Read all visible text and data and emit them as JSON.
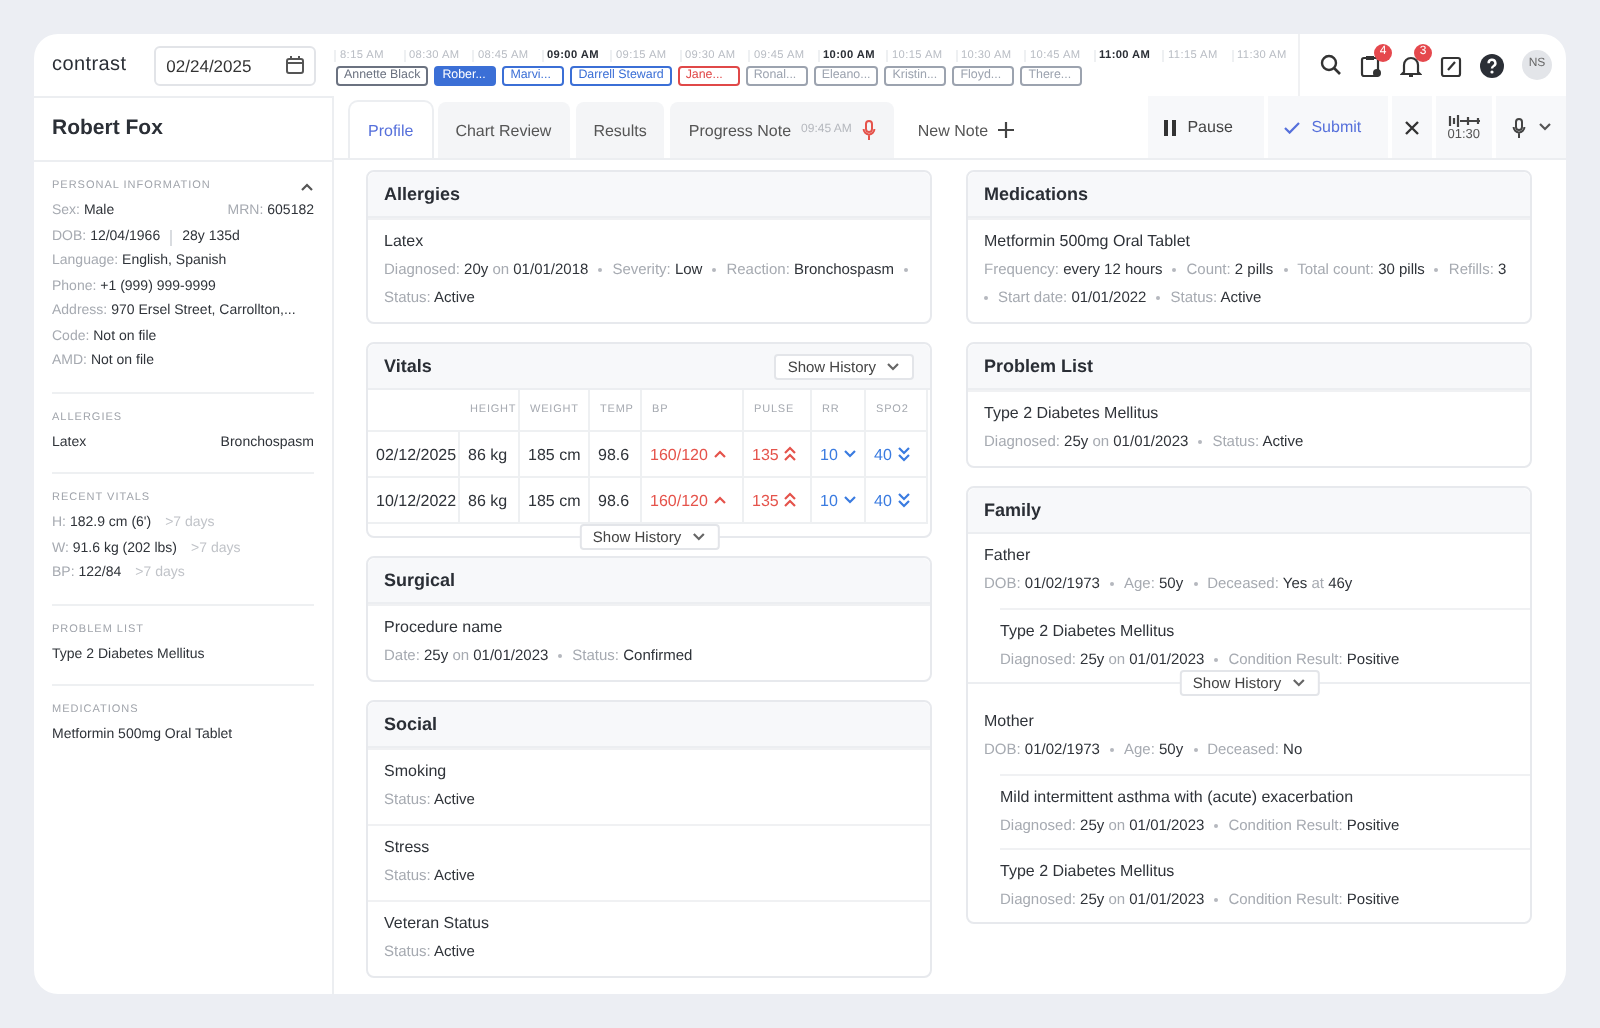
{
  "app": {
    "logo": "contrast",
    "date": "02/24/2025"
  },
  "schedule": {
    "times": [
      {
        "label": "8:15 AM",
        "major": false
      },
      {
        "label": "08:30 AM",
        "major": false
      },
      {
        "label": "08:45 AM",
        "major": false
      },
      {
        "label": "09:00 AM",
        "major": true
      },
      {
        "label": "09:15 AM",
        "major": false
      },
      {
        "label": "09:30 AM",
        "major": false
      },
      {
        "label": "09:45 AM",
        "major": false
      },
      {
        "label": "10:00 AM",
        "major": true
      },
      {
        "label": "10:15 AM",
        "major": false
      },
      {
        "label": "10:30 AM",
        "major": false
      },
      {
        "label": "10:45 AM",
        "major": false
      },
      {
        "label": "11:00 AM",
        "major": true
      },
      {
        "label": "11:15 AM",
        "major": false
      },
      {
        "label": "11:30 AM",
        "major": false
      }
    ],
    "appointments": [
      {
        "name": "Annette Black",
        "color": "#6b7280",
        "selected": false
      },
      {
        "name": "Rober...",
        "color": "#3b6fd6",
        "selected": true
      },
      {
        "name": "Marvi...",
        "color": "#3b6fd6",
        "selected": false
      },
      {
        "name": "Darrell Steward",
        "color": "#3b6fd6",
        "selected": false
      },
      {
        "name": "Jane...",
        "color": "#e04848",
        "selected": false
      },
      {
        "name": "Ronal...",
        "color": "#9ca3af",
        "selected": false
      },
      {
        "name": "Eleano...",
        "color": "#9ca3af",
        "selected": false
      },
      {
        "name": "Kristin...",
        "color": "#9ca3af",
        "selected": false
      },
      {
        "name": "Floyd...",
        "color": "#9ca3af",
        "selected": false
      },
      {
        "name": "There...",
        "color": "#9ca3af",
        "selected": false
      }
    ]
  },
  "toolbar": {
    "icons": [
      {
        "kind": "search"
      },
      {
        "kind": "clipboard",
        "badge": "4"
      },
      {
        "kind": "bell",
        "badge": "3"
      },
      {
        "kind": "edit"
      },
      {
        "kind": "help"
      }
    ],
    "user_initials": "NS"
  },
  "patient": {
    "name": "Robert Fox",
    "sections": [
      {
        "kind": "personal",
        "title": "PERSONAL INFORMATION",
        "expanded": true,
        "rows": [
          {
            "items": [
              "Sex: **Male**",
              "MRN: **605182**"
            ]
          },
          {
            "items": [
              "DOB: **12/04/1966**"
            ],
            "age": "28y 135d"
          },
          {
            "items": [
              "Language: **English, Spanish**"
            ]
          },
          {
            "items": [
              "Phone: **+1 (999) 999-9999**"
            ]
          },
          {
            "items": [
              "Address: **970 Ersel Street, Carrollton,...**"
            ]
          },
          {
            "items": [
              "Code: **Not on file**"
            ]
          },
          {
            "items": [
              "AMD: **Not on file**"
            ]
          }
        ]
      },
      {
        "kind": "allergies",
        "title": "ALLERGIES",
        "items": [
          {
            "name": "Latex",
            "reaction": "Bronchospasm"
          }
        ]
      },
      {
        "kind": "vitals",
        "title": "RECENT VITALS",
        "items": [
          {
            "text": "H: **182.9 cm (6')**",
            "age": ">7 days"
          },
          {
            "text": "W: **91.6 kg (202 lbs)**",
            "age": ">7 days"
          },
          {
            "text": "BP: **122/84**",
            "age": ">7 days"
          }
        ]
      },
      {
        "kind": "list",
        "title": "PROBLEM LIST",
        "items": [
          "Type 2 Diabetes Mellitus"
        ]
      },
      {
        "kind": "list",
        "title": "MEDICATIONS",
        "items": [
          "Metformin 500mg Oral Tablet"
        ]
      }
    ]
  },
  "tabs": [
    {
      "label": "Profile",
      "kind": "tab",
      "selected": true,
      "recording": false
    },
    {
      "label": "Chart Review",
      "kind": "tab",
      "selected": false,
      "recording": false
    },
    {
      "label": "Results",
      "kind": "tab",
      "selected": false,
      "recording": false
    },
    {
      "label": "Progress Note",
      "kind": "tab",
      "selected": false,
      "time": "09:45 AM",
      "recording": true
    },
    {
      "label": "New Note",
      "kind": "new",
      "selected": false,
      "recording": false
    }
  ],
  "note_controls": {
    "pause": "Pause",
    "submit": "Submit",
    "elapsed": "01:30"
  },
  "profile": {
    "columns": [
      [
        {
          "kind": "records",
          "title": "Allergies",
          "items": [
            {
              "name": "Latex",
              "facts": [
                "Diagnosed: **20y** on **01/01/2018**",
                "Severity: **Low**",
                "Reaction: **Bronchospasm**",
                "Status: **Active**"
              ]
            }
          ]
        },
        {
          "kind": "vitals",
          "title": "Vitals",
          "history_buttons": [
            "Show History",
            "Show History"
          ],
          "columns": [
            "HEIGHT",
            "WEIGHT",
            "TEMP",
            "BP",
            "PULSE",
            "RR",
            "SPO2"
          ],
          "rows": [
            {
              "date": "02/12/2025",
              "cells": [
                {
                  "value": "86 kg",
                  "high": false,
                  "low": false
                },
                {
                  "value": "185 cm",
                  "high": false,
                  "low": false
                },
                {
                  "value": "98.6",
                  "high": false,
                  "low": false
                },
                {
                  "value": "160/120",
                  "high": true,
                  "low": false,
                  "strong": false
                },
                {
                  "value": "135",
                  "high": true,
                  "low": false,
                  "strong": true
                },
                {
                  "value": "10",
                  "high": false,
                  "low": true,
                  "strong": false
                },
                {
                  "value": "40",
                  "high": false,
                  "low": true,
                  "strong": true
                }
              ]
            },
            {
              "date": "10/12/2022",
              "cells": [
                {
                  "value": "86 kg",
                  "high": false,
                  "low": false
                },
                {
                  "value": "185 cm",
                  "high": false,
                  "low": false
                },
                {
                  "value": "98.6",
                  "high": false,
                  "low": false
                },
                {
                  "value": "160/120",
                  "high": true,
                  "low": false,
                  "strong": false
                },
                {
                  "value": "135",
                  "high": true,
                  "low": false,
                  "strong": true
                },
                {
                  "value": "10",
                  "high": false,
                  "low": true,
                  "strong": false
                },
                {
                  "value": "40",
                  "high": false,
                  "low": true,
                  "strong": true
                }
              ]
            }
          ]
        },
        {
          "kind": "records",
          "title": "Surgical",
          "items": [
            {
              "name": "Procedure name",
              "facts": [
                "Date: **25y** on **01/01/2023**",
                "Status: **Confirmed**"
              ]
            }
          ]
        },
        {
          "kind": "records",
          "title": "Social",
          "items": [
            {
              "name": "Smoking",
              "facts": [
                "Status: **Active**"
              ]
            },
            {
              "name": "Stress",
              "facts": [
                "Status: **Active**"
              ]
            },
            {
              "name": "Veteran Status",
              "facts": [
                "Status: **Active**"
              ]
            }
          ]
        }
      ],
      [
        {
          "kind": "records",
          "title": "Medications",
          "items": [
            {
              "name": "Metformin 500mg Oral Tablet",
              "facts": [
                "Frequency: **every 12 hours**",
                "Count: **2 pills**",
                "Total count: **30 pills**",
                "Refills: **3**",
                "Start date: **01/01/2022**",
                "Status: **Active**"
              ]
            }
          ]
        },
        {
          "kind": "records",
          "title": "Problem List",
          "items": [
            {
              "name": "Type 2 Diabetes Mellitus",
              "facts": [
                "Diagnosed: **25y** on **01/01/2023**",
                "Status: **Active**"
              ]
            }
          ]
        },
        {
          "kind": "family",
          "title": "Family",
          "members": [
            {
              "name": "Father",
              "facts": [
                "DOB: **01/02/1973**",
                "Age: **50y**",
                "Deceased: **Yes** at **46y**"
              ],
              "conditions": [
                {
                  "name": "Type 2 Diabetes Mellitus",
                  "facts": [
                    "Diagnosed: **25y** on **01/01/2023**",
                    "Condition Result: **Positive**"
                  ]
                }
              ],
              "history_button": "Show History"
            },
            {
              "name": "Mother",
              "facts": [
                "DOB: **01/02/1973**",
                "Age: **50y**",
                "Deceased: **No**"
              ],
              "conditions": [
                {
                  "name": "Mild intermittent asthma with (acute) exacerbation",
                  "facts": [
                    "Diagnosed: **25y** on **01/01/2023**",
                    "Condition Result: **Positive**"
                  ]
                },
                {
                  "name": "Type 2 Diabetes Mellitus",
                  "facts": [
                    "Diagnosed: **25y** on **01/01/2023**",
                    "Condition Result: **Positive**"
                  ]
                }
              ]
            }
          ]
        }
      ]
    ]
  }
}
